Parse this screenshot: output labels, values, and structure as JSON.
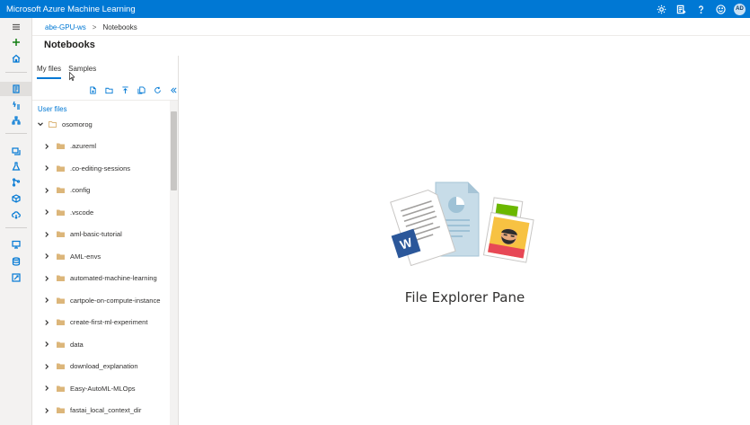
{
  "header": {
    "app_title": "Microsoft Azure Machine Learning",
    "icons": [
      "settings-icon",
      "feedback-list-icon",
      "help-icon",
      "smiley-icon"
    ],
    "avatar_initials": "AD",
    "bar_color": "#0078d4"
  },
  "leftnav": {
    "icons": [
      "hamburger-icon",
      "add-icon",
      "home-icon",
      "notebooks-icon",
      "automl-icon",
      "designer-icon",
      "datasets-icon",
      "experiments-icon",
      "pipelines-icon",
      "models-icon",
      "endpoints-icon",
      "compute-icon",
      "datastores-icon",
      "labeling-icon"
    ]
  },
  "breadcrumb": {
    "workspace": "abe-GPU-ws",
    "separator": ">",
    "current": "Notebooks"
  },
  "page": {
    "title": "Notebooks"
  },
  "filepane": {
    "tabs": [
      {
        "label": "My files",
        "active": true
      },
      {
        "label": "Samples",
        "active": false
      }
    ],
    "toolbar": [
      "new-file-icon",
      "new-folder-icon",
      "upload-icon",
      "copy-icon",
      "refresh-icon",
      "collapse-icon"
    ],
    "section_label": "User files",
    "root": {
      "name": "osomorog",
      "expanded": true
    },
    "items": [
      {
        "name": ".azureml"
      },
      {
        "name": ".co-editing-sessions"
      },
      {
        "name": ".config"
      },
      {
        "name": ".vscode"
      },
      {
        "name": "aml-basic-tutorial"
      },
      {
        "name": "AML-envs"
      },
      {
        "name": "automated-machine-learning"
      },
      {
        "name": "cartpole-on-compute-instance"
      },
      {
        "name": "create-first-ml-experiment"
      },
      {
        "name": "data"
      },
      {
        "name": "download_explanation"
      },
      {
        "name": "Easy-AutoML-MLOps"
      },
      {
        "name": "fastai_local_context_dir"
      }
    ]
  },
  "main": {
    "empty_label": "File Explorer Pane"
  },
  "colors": {
    "accent": "#0078d4",
    "folder": "#dcb67a",
    "word_blue": "#2b579a"
  }
}
